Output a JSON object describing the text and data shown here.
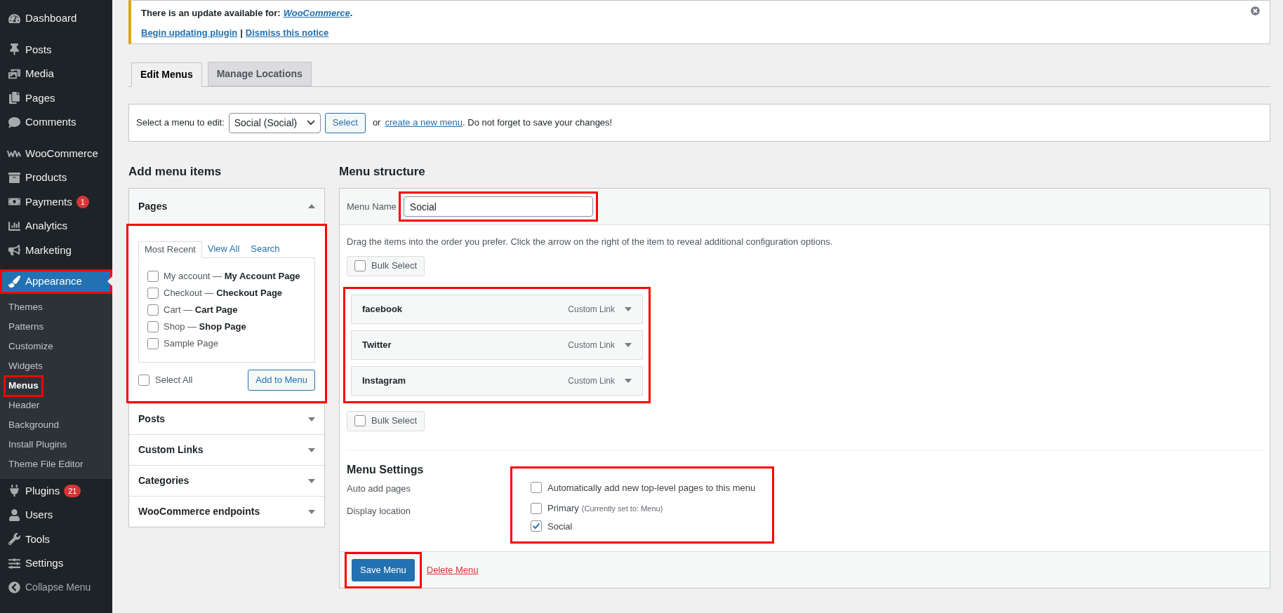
{
  "sidebar": {
    "groups": [
      [
        {
          "label": "Dashboard",
          "selected": false,
          "highlighted": false
        }
      ],
      [
        {
          "label": "Posts",
          "selected": false,
          "highlighted": false
        },
        {
          "label": "Media",
          "selected": false,
          "highlighted": false
        },
        {
          "label": "Pages",
          "selected": false,
          "highlighted": false
        },
        {
          "label": "Comments",
          "selected": false,
          "highlighted": false
        }
      ],
      [
        {
          "label": "WooCommerce",
          "selected": false,
          "highlighted": false
        },
        {
          "label": "Products",
          "selected": false,
          "highlighted": false
        },
        {
          "label": "Payments",
          "badge": "1",
          "selected": false,
          "highlighted": false
        },
        {
          "label": "Analytics",
          "selected": false,
          "highlighted": false
        },
        {
          "label": "Marketing",
          "selected": false,
          "highlighted": false
        }
      ],
      [
        {
          "label": "Appearance",
          "selected": true,
          "highlighted": true,
          "children": [
            {
              "label": "Themes",
              "selected": false,
              "highlighted": false
            },
            {
              "label": "Patterns",
              "selected": false,
              "highlighted": false
            },
            {
              "label": "Customize",
              "selected": false,
              "highlighted": false
            },
            {
              "label": "Widgets",
              "selected": false,
              "highlighted": false
            },
            {
              "label": "Menus",
              "selected": true,
              "highlighted": true
            },
            {
              "label": "Header",
              "selected": false,
              "highlighted": false
            },
            {
              "label": "Background",
              "selected": false,
              "highlighted": false
            },
            {
              "label": "Install Plugins",
              "selected": false,
              "highlighted": false
            },
            {
              "label": "Theme File Editor",
              "selected": false,
              "highlighted": false
            }
          ]
        },
        {
          "label": "Plugins",
          "badge": "21",
          "selected": false,
          "highlighted": false
        },
        {
          "label": "Users",
          "selected": false,
          "highlighted": false
        },
        {
          "label": "Tools",
          "selected": false,
          "highlighted": false
        },
        {
          "label": "Settings",
          "selected": false,
          "highlighted": false
        },
        {
          "label": "Collapse Menu",
          "selected": false,
          "highlighted": false
        }
      ]
    ]
  },
  "notice": {
    "text": "There is an update available for: ",
    "link": "WooCommerce",
    "after": ".",
    "actions": [
      "Begin updating plugin",
      "Dismiss this notice"
    ],
    "separator": "|"
  },
  "tabs": [
    {
      "label": "Edit Menus",
      "selected": true
    },
    {
      "label": "Manage Locations",
      "selected": false
    }
  ],
  "menu_select": {
    "label": "Select a menu to edit:",
    "value": "Social (Social)",
    "button": "Select",
    "before_link": "or",
    "link": "create a new menu",
    "after_link": ". Do not forget to save your changes!"
  },
  "add_menu_items": {
    "title": "Add menu items",
    "sections": [
      {
        "title": "Pages",
        "expanded": true,
        "highlighted": true,
        "tabs": [
          {
            "label": "Most Recent",
            "selected": true
          },
          {
            "label": "View All",
            "selected": false
          },
          {
            "label": "Search",
            "selected": false
          }
        ],
        "items": [
          {
            "label": "My account — **My Account Page**",
            "checked": false
          },
          {
            "label": "Checkout — **Checkout Page**",
            "checked": false
          },
          {
            "label": "Cart — **Cart Page**",
            "checked": false
          },
          {
            "label": "Shop — **Shop Page**",
            "checked": false
          },
          {
            "label": "Sample Page",
            "checked": false
          }
        ],
        "select_all": {
          "label": "Select All",
          "checked": false
        },
        "button": "Add to Menu"
      },
      {
        "title": "Posts",
        "expanded": false
      },
      {
        "title": "Custom Links",
        "expanded": false
      },
      {
        "title": "Categories",
        "expanded": false
      },
      {
        "title": "WooCommerce endpoints",
        "expanded": false
      }
    ]
  },
  "menu_structure": {
    "title": "Menu structure",
    "name_label": "Menu Name",
    "name_value": "Social",
    "name_highlighted": true,
    "instructions": "Drag the items into the order you prefer. Click the arrow on the right of the item to reveal additional configuration options.",
    "bulk_select": [
      {
        "label": "Bulk Select",
        "checked": false
      },
      {
        "label": "Bulk Select",
        "checked": false
      }
    ],
    "items_highlighted": true,
    "items": [
      {
        "title": "facebook",
        "type": "Custom Link"
      },
      {
        "title": "Twitter",
        "type": "Custom Link"
      },
      {
        "title": "Instagram",
        "type": "Custom Link"
      }
    ],
    "settings": {
      "title": "Menu Settings",
      "highlighted": true,
      "rows": [
        {
          "label": "Auto add pages",
          "options": [
            {
              "label": "Automatically add new top-level pages to this menu",
              "checked": false
            }
          ]
        },
        {
          "label": "Display location",
          "options": [
            {
              "label": "Primary",
              "note": "(Currently set to: Menu)",
              "checked": false
            },
            {
              "label": "Social",
              "checked": true
            }
          ]
        }
      ]
    },
    "save_button": {
      "label": "Save Menu",
      "highlighted": true
    },
    "delete_link": "Delete Menu"
  }
}
